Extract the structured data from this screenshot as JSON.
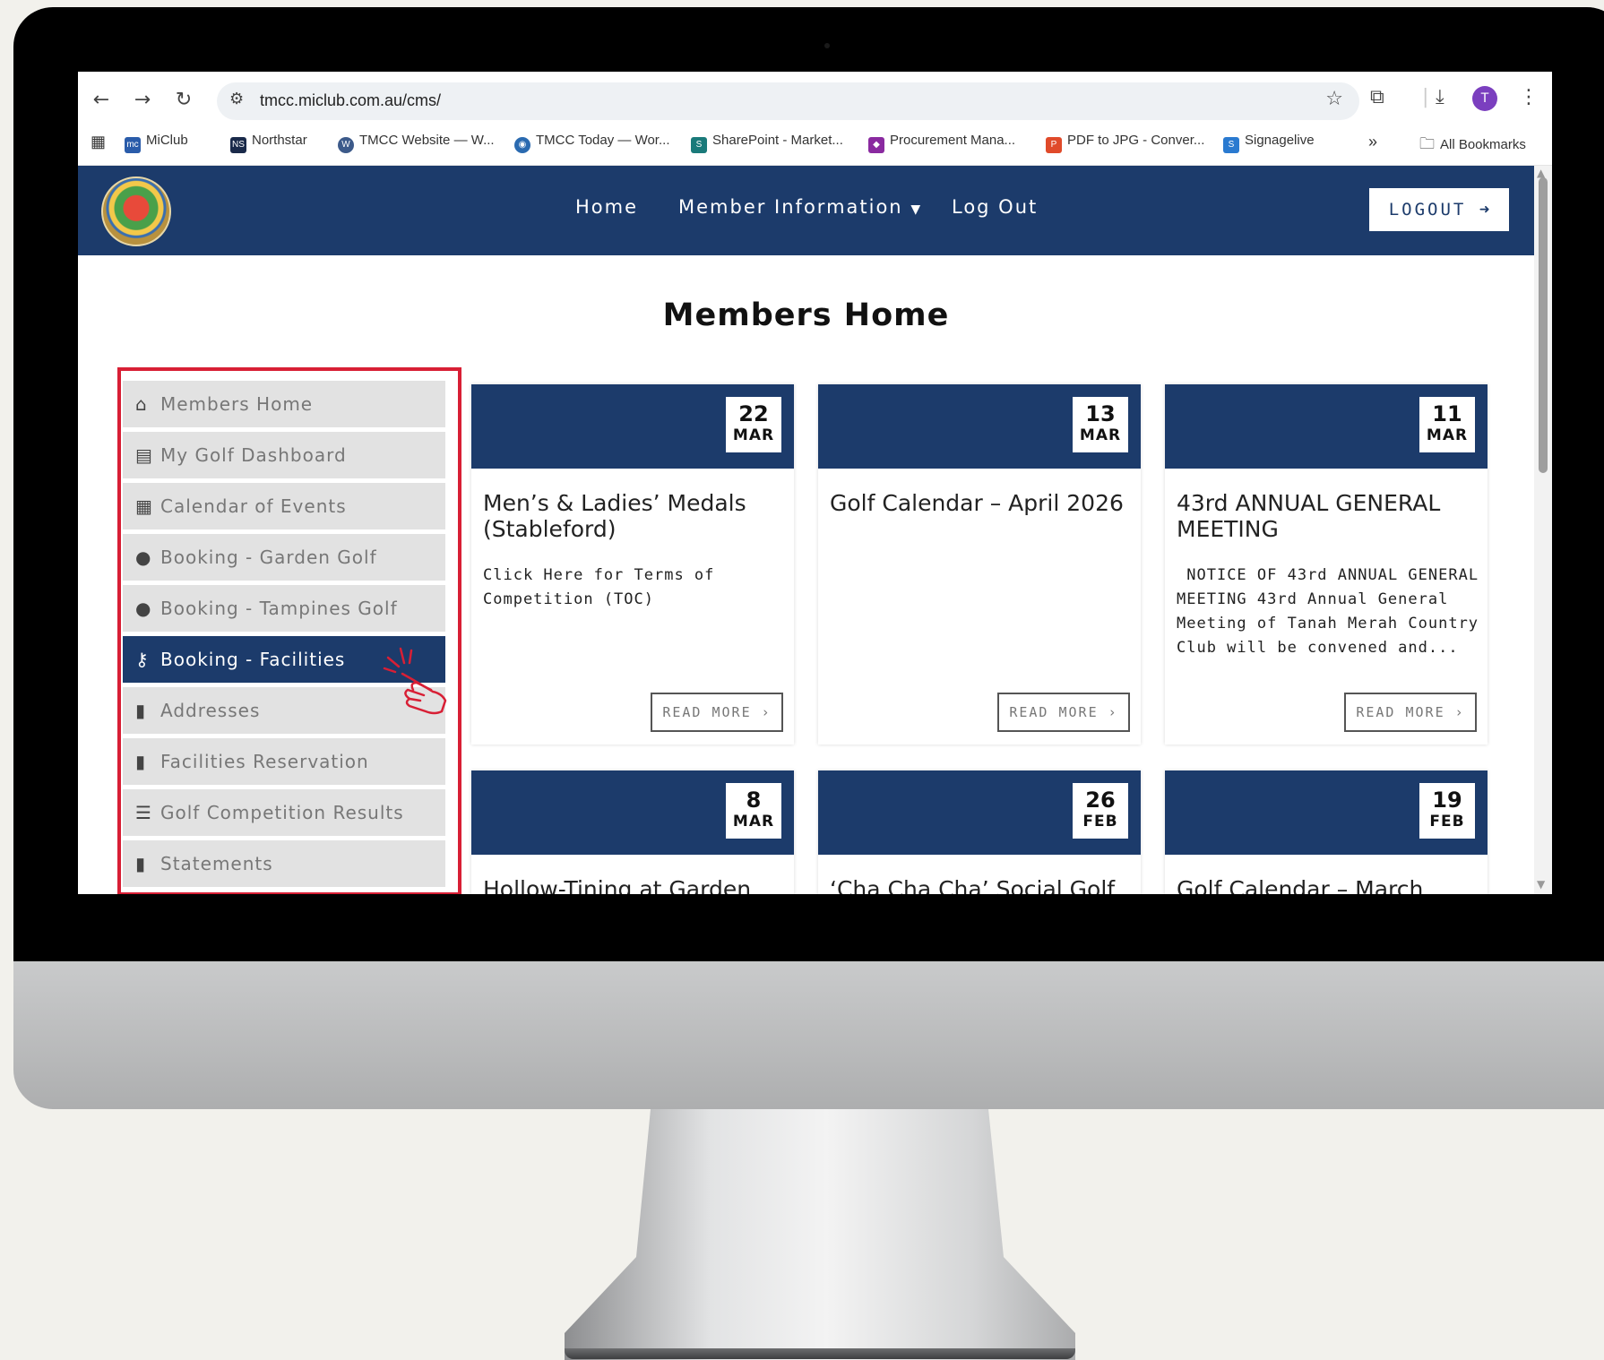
{
  "browser": {
    "url": "tmcc.miclub.com.au/cms/",
    "avatar_letter": "T",
    "bookmarks": [
      {
        "label": "MiClub",
        "color": "#2a5caa",
        "badge": "mc"
      },
      {
        "label": "Northstar",
        "color": "#1a2a4a",
        "badge": "NS"
      },
      {
        "label": "TMCC Website — W...",
        "color": "#3c5a8a",
        "badge": "W"
      },
      {
        "label": "TMCC Today — Wor...",
        "color": "#2a6ab0",
        "badge": "◉"
      },
      {
        "label": "SharePoint - Market...",
        "color": "#1a7a7a",
        "badge": "S"
      },
      {
        "label": "Procurement Mana...",
        "color": "#8a2aa0",
        "badge": "◆"
      },
      {
        "label": "PDF to JPG - Conver...",
        "color": "#e04a2a",
        "badge": "P"
      },
      {
        "label": "Signagelive",
        "color": "#2a7ad0",
        "badge": "S"
      }
    ],
    "overflow": "»",
    "all_bookmarks": "All Bookmarks"
  },
  "header": {
    "nav": [
      "Home",
      "Member Information",
      "Log Out"
    ],
    "logout_button": "LOGOUT"
  },
  "page_title": "Members Home",
  "sidebar": {
    "items": [
      {
        "label": "Members Home",
        "icon": "home-icon",
        "glyph": "⌂"
      },
      {
        "label": "My Golf Dashboard",
        "icon": "id-card-icon",
        "glyph": "▤"
      },
      {
        "label": "Calendar of Events",
        "icon": "calendar-icon",
        "glyph": "▦"
      },
      {
        "label": "Booking - Garden Golf",
        "icon": "map-pin-icon",
        "glyph": "●"
      },
      {
        "label": "Booking - Tampines Golf",
        "icon": "map-pin-icon",
        "glyph": "●"
      },
      {
        "label": "Booking - Facilities",
        "icon": "key-icon",
        "glyph": "⚷"
      },
      {
        "label": "Addresses",
        "icon": "book-icon",
        "glyph": "▮"
      },
      {
        "label": "Facilities Reservation",
        "icon": "book-icon",
        "glyph": "▮"
      },
      {
        "label": "Golf Competition Results",
        "icon": "list-icon",
        "glyph": "☰"
      },
      {
        "label": "Statements",
        "icon": "book-icon",
        "glyph": "▮"
      }
    ],
    "active_index": 5
  },
  "cards": [
    {
      "day": "22",
      "month": "MAR",
      "title": "Men’s & Ladies’ Medals (Stableford)",
      "text": "Click Here for Terms of Competition (TOC)",
      "button": "READ MORE"
    },
    {
      "day": "13",
      "month": "MAR",
      "title": "Golf Calendar – April 2026",
      "text": "",
      "button": "READ MORE"
    },
    {
      "day": "11",
      "month": "MAR",
      "title": "43rd ANNUAL GENERAL MEETING",
      "text": " NOTICE OF 43rd ANNUAL GENERAL MEETING 43rd Annual General Meeting of Tanah Merah Country Club will be convened and...",
      "button": "READ MORE"
    },
    {
      "day": "8",
      "month": "MAR",
      "title": "Hollow-Tining at Garden"
    },
    {
      "day": "26",
      "month": "FEB",
      "title": "‘Cha Cha Cha’ Social Golf"
    },
    {
      "day": "19",
      "month": "FEB",
      "title": "Golf Calendar – March"
    }
  ],
  "colors": {
    "navy": "#1c3b6b",
    "highlight": "#d81f35",
    "sidebar_bg": "#e2e2e2"
  }
}
